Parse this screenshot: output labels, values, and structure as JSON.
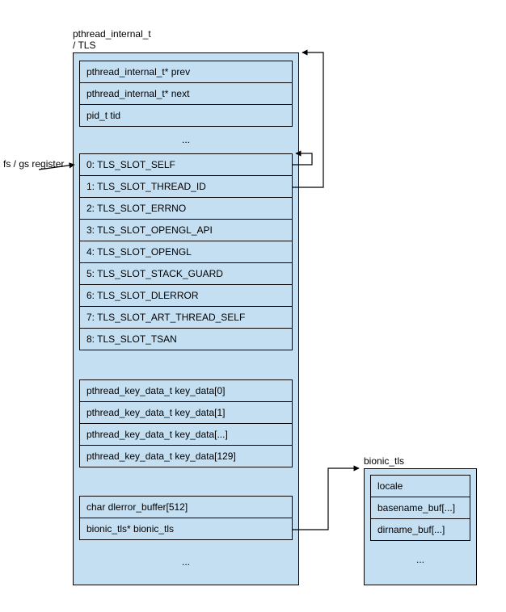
{
  "main": {
    "label_top": "pthread_internal_t",
    "label_bottom": "/ TLS",
    "group1": [
      "pthread_internal_t* prev",
      "pthread_internal_t* next",
      "pid_t tid"
    ],
    "ellipsis1": "...",
    "group2": [
      "0: TLS_SLOT_SELF",
      "1: TLS_SLOT_THREAD_ID",
      "2: TLS_SLOT_ERRNO",
      "3: TLS_SLOT_OPENGL_API",
      "4: TLS_SLOT_OPENGL",
      "5: TLS_SLOT_STACK_GUARD",
      "6: TLS_SLOT_DLERROR",
      "7: TLS_SLOT_ART_THREAD_SELF",
      "8: TLS_SLOT_TSAN"
    ],
    "group3": [
      "pthread_key_data_t key_data[0]",
      "pthread_key_data_t key_data[1]",
      "pthread_key_data_t key_data[...]",
      "pthread_key_data_t key_data[129]"
    ],
    "group4": [
      "char dlerror_buffer[512]",
      "bionic_tls* bionic_tls"
    ]
  },
  "side": {
    "label": "bionic_tls",
    "rows": [
      "locale",
      "basename_buf[...]",
      "dirname_buf[...]"
    ],
    "ellipsis": "..."
  },
  "register_label": "fs / gs register"
}
